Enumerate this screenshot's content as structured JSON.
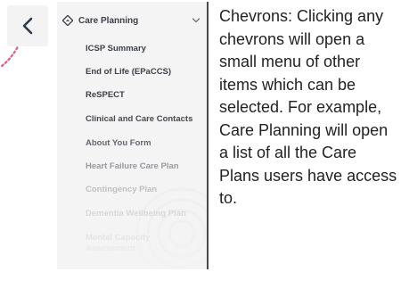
{
  "nav": {
    "back_icon": "chevron-left-icon"
  },
  "menu": {
    "header": {
      "icon": "diamond-route-icon",
      "label": "Care Planning",
      "toggle_icon": "chevron-down-icon"
    },
    "items": [
      {
        "label": "ICSP Summary",
        "color": "#3b3f46"
      },
      {
        "label": "End of Life (EPaCCS)",
        "color": "#3b3f46"
      },
      {
        "label": "ReSPECT",
        "color": "#3b3f46"
      },
      {
        "label": "Clinical and Care Contacts",
        "color": "#444950"
      },
      {
        "label": "About You Form",
        "color": "#5c6067"
      },
      {
        "label": "Heart Failure Care Plan",
        "color": "#7f8389"
      },
      {
        "label": "Contingency Plan",
        "color": "#a2a5aa"
      },
      {
        "label": "Dementia Wellbeing Plan",
        "color": "#bbbdc1"
      },
      {
        "label": "Mental Capacity",
        "color": "#c6c8cb"
      },
      {
        "label": "Assessment",
        "color": "#cfd1d3"
      }
    ]
  },
  "explanation": "Chevrons: Clicking any chevrons will open a small menu of other items which can be selected. For example, Care Planning will open a list of all the Care Plans users have access to.",
  "colors": {
    "accent_pink": "#d6669a",
    "panel_bg": "#f4f4f4",
    "text_dark": "#3b3f46"
  }
}
